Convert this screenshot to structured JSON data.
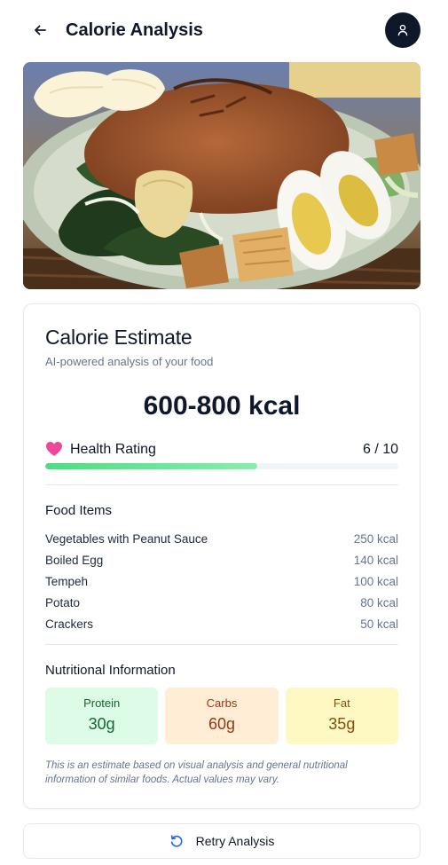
{
  "header": {
    "title": "Calorie Analysis",
    "back_icon": "arrow-left-icon",
    "profile_icon": "user-icon"
  },
  "estimate": {
    "title": "Calorie Estimate",
    "subtitle": "AI-powered analysis of your food",
    "kcal_range": "600-800 kcal"
  },
  "health": {
    "label": "Health Rating",
    "value_text": "6 / 10",
    "rating": 6,
    "max": 10,
    "icon": "heart-icon",
    "accent": "#ec4899"
  },
  "food_items": {
    "title": "Food Items",
    "items": [
      {
        "name": "Vegetables with Peanut Sauce",
        "kcal": "250 kcal"
      },
      {
        "name": "Boiled Egg",
        "kcal": "140 kcal"
      },
      {
        "name": "Tempeh",
        "kcal": "100 kcal"
      },
      {
        "name": "Potato",
        "kcal": "80 kcal"
      },
      {
        "name": "Crackers",
        "kcal": "50 kcal"
      }
    ]
  },
  "nutrition": {
    "title": "Nutritional Information",
    "macros": [
      {
        "label": "Protein",
        "value": "30g",
        "color": "#dcfce7"
      },
      {
        "label": "Carbs",
        "value": "60g",
        "color": "#ffedd5"
      },
      {
        "label": "Fat",
        "value": "35g",
        "color": "#fef9c3"
      }
    ]
  },
  "disclaimer": "This is an estimate based on visual analysis and general nutritional information of similar foods. Actual values may vary.",
  "retry": {
    "label": "Retry Analysis",
    "icon": "refresh-icon"
  }
}
